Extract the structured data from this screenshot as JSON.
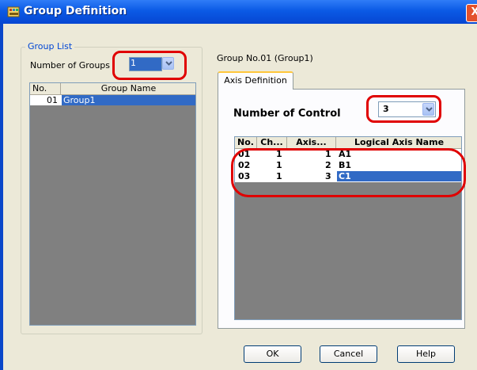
{
  "window": {
    "title": "Group Definition",
    "close_glyph": "X"
  },
  "group_list": {
    "legend": "Group List",
    "num_groups_label": "Number of Groups",
    "num_groups_value": "1",
    "columns": [
      "No.",
      "Group Name"
    ],
    "rows": [
      {
        "no": "01",
        "name": "Group1",
        "selected": true
      }
    ]
  },
  "group_header": "Group No.01 (Group1)",
  "tab_label": "Axis Definition",
  "axis": {
    "num_control_label": "Number of Control",
    "num_control_value": "3",
    "columns": [
      "No.",
      "Ch...",
      "Axis...",
      "Logical Axis Name"
    ],
    "rows": [
      {
        "no": "01",
        "ch": "1",
        "axis": "1",
        "name": "A1",
        "selected": false
      },
      {
        "no": "02",
        "ch": "1",
        "axis": "2",
        "name": "B1",
        "selected": false
      },
      {
        "no": "03",
        "ch": "1",
        "axis": "3",
        "name": "C1",
        "selected": true
      }
    ]
  },
  "buttons": {
    "ok": "OK",
    "cancel": "Cancel",
    "help": "Help"
  },
  "colors": {
    "accent": "#0046d5",
    "selection": "#316ac5",
    "highlight_ring": "#e00000"
  }
}
